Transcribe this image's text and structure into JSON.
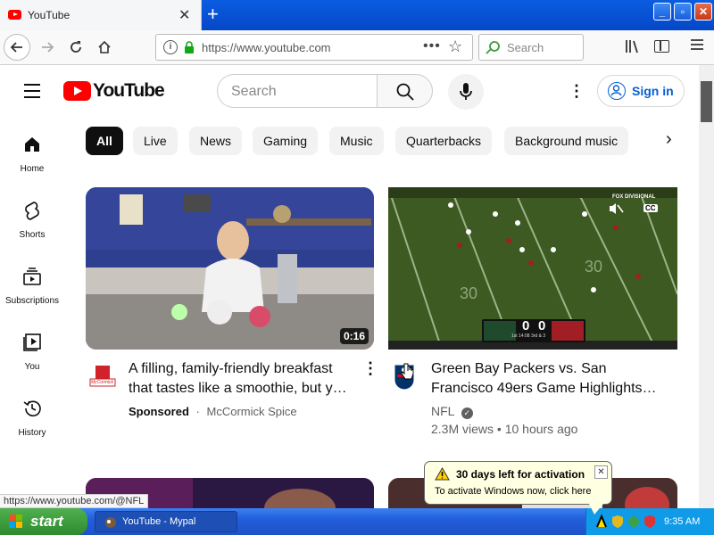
{
  "browser": {
    "tab_title": "YouTube",
    "tab_close": "✕",
    "new_tab": "+",
    "url": "https://www.youtube.com",
    "search_placeholder": "Search",
    "page_actions": "•••",
    "bookmark_star": "☆",
    "window_controls": {
      "min": "_",
      "max": "▫",
      "close": "✕"
    }
  },
  "youtube": {
    "brand": "YouTube",
    "search_placeholder": "Search",
    "more_menu": "⋮",
    "sign_in": "Sign in",
    "nav": [
      {
        "label": "Home",
        "icon": "home-icon"
      },
      {
        "label": "Shorts",
        "icon": "shorts-icon"
      },
      {
        "label": "Subscriptions",
        "icon": "subscriptions-icon"
      },
      {
        "label": "You",
        "icon": "you-icon"
      },
      {
        "label": "History",
        "icon": "history-icon"
      }
    ],
    "chips": [
      "All",
      "Live",
      "News",
      "Gaming",
      "Music",
      "Quarterbacks",
      "Background music"
    ],
    "chip_next": "›",
    "videos": [
      {
        "title_line1": "A filling, family-friendly breakfast",
        "title_line2": "that tastes like a smoothie, but y…",
        "sponsored": "Sponsored",
        "channel": "McCormick Spice",
        "duration": "0:16",
        "menu": "⋮",
        "channel_logo_text": "McCormick"
      },
      {
        "title_line1": "Green Bay Packers vs. San",
        "title_line2": "Francisco 49ers Game Highlights…",
        "channel": "NFL",
        "meta": "2.3M views • 10 hours ago",
        "verified": "✓",
        "scoreboard": {
          "left": "0",
          "right": "0",
          "info": "1st 14:08 3rd & 3"
        },
        "overlay_badge": "CC",
        "overlay_network": "FOX DIVISIONAL"
      }
    ]
  },
  "status_url": "https://www.youtube.com/@NFL",
  "taskbar": {
    "start": "start",
    "task_label": "YouTube - Mypal",
    "clock": "9:35 AM"
  },
  "balloon": {
    "title": "30 days left for activation",
    "message": "To activate Windows now, click here",
    "close": "✕"
  }
}
